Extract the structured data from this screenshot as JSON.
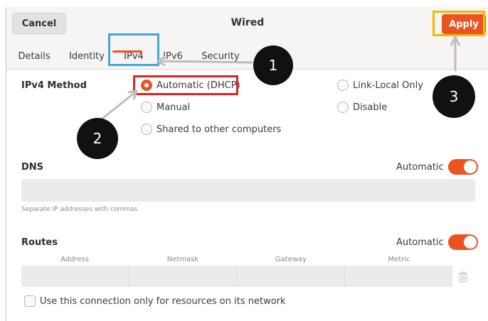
{
  "header": {
    "cancel_label": "Cancel",
    "title": "Wired",
    "apply_label": "Apply"
  },
  "tabs": [
    {
      "label": "Details"
    },
    {
      "label": "Identity"
    },
    {
      "label": "IPv4",
      "active": true
    },
    {
      "label": "IPv6"
    },
    {
      "label": "Security"
    }
  ],
  "ipv4_method": {
    "label": "IPv4 Method",
    "options": [
      {
        "label": "Automatic (DHCP)",
        "selected": true
      },
      {
        "label": "Manual",
        "selected": false
      },
      {
        "label": "Shared to other computers",
        "selected": false
      },
      {
        "label": "Link-Local Only",
        "selected": false
      },
      {
        "label": "Disable",
        "selected": false
      }
    ]
  },
  "dns": {
    "label": "DNS",
    "automatic_label": "Automatic",
    "automatic_on": true,
    "value": "",
    "hint": "Separate IP addresses with commas"
  },
  "routes": {
    "label": "Routes",
    "automatic_label": "Automatic",
    "automatic_on": true,
    "columns": [
      "Address",
      "Netmask",
      "Gateway",
      "Metric"
    ]
  },
  "only_local_resources": {
    "label": "Use this connection only for resources on its network",
    "checked": false
  },
  "callouts": [
    "1",
    "2",
    "3"
  ],
  "colors": {
    "accent": "#e95420",
    "highlight_tab": "#40a7dc",
    "highlight_dhcp": "#e02424",
    "highlight_apply": "#f5b800",
    "callout_bg": "#111111"
  }
}
